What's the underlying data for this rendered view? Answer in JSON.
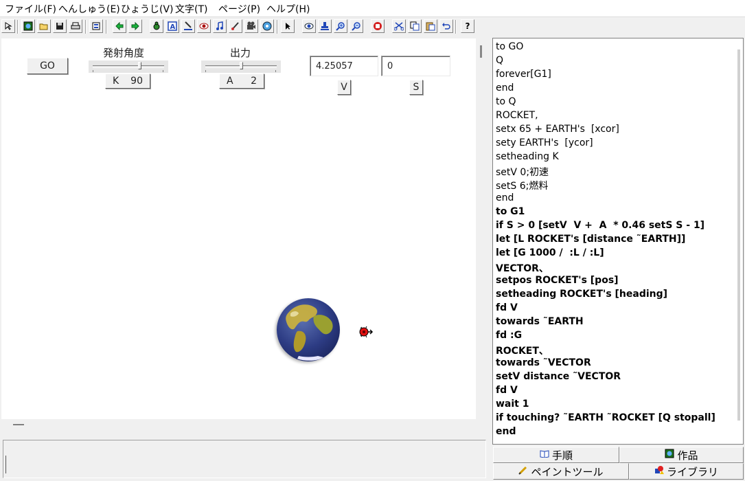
{
  "menu": [
    "ファイル(F)",
    "へんしゅう(E)",
    "ひょうじ(V)",
    "文字(T)",
    "ページ(P)",
    "ヘルプ(H)"
  ],
  "toolbar": {
    "icons": [
      "pointer-icon",
      "new-page-icon",
      "open-icon",
      "save-icon",
      "print-icon",
      "page-list-icon",
      "prev-page-icon",
      "next-page-icon",
      "turtle-icon",
      "text-box-icon",
      "paint-tool-icon",
      "eye-icon",
      "music-icon",
      "brush-icon",
      "video-icon",
      "cd-icon",
      "arrow-icon",
      "eye-watch-icon",
      "stamp-icon",
      "zoom-in-icon",
      "zoom-out-icon",
      "stop-hand-icon",
      "cut-icon",
      "copy-icon",
      "paste-icon",
      "undo-icon",
      "help-icon"
    ],
    "help_label": "?"
  },
  "canvas": {
    "go_button": "GO",
    "angle_label": "発射角度",
    "angle_slider": {
      "name": "K",
      "value": "90",
      "level": 0.55
    },
    "power_label": "出力",
    "power_slider": {
      "name": "A",
      "value": "2",
      "level": 0.5
    },
    "v_value": "4.25057",
    "v_button": "V",
    "s_value": "0",
    "s_button": "S",
    "earth_name": "EARTH",
    "rocket_name": "ROCKET"
  },
  "command_center": {
    "text": ""
  },
  "editor": {
    "lines": [
      {
        "text": "to GO",
        "bold": false
      },
      {
        "text": "Q",
        "bold": false
      },
      {
        "text": "forever[G1]",
        "bold": false
      },
      {
        "text": "end",
        "bold": false
      },
      {
        "text": "to Q",
        "bold": false
      },
      {
        "text": "ROCKET,",
        "bold": false
      },
      {
        "text": "setx 65 + EARTH's  [xcor]",
        "bold": false
      },
      {
        "text": "sety EARTH's  [ycor]",
        "bold": false
      },
      {
        "text": "setheading K",
        "bold": false
      },
      {
        "text": "setV 0;初速",
        "bold": false
      },
      {
        "text": "setS 6;燃料",
        "bold": false
      },
      {
        "text": "end",
        "bold": false
      },
      {
        "text": "to G1",
        "bold": true
      },
      {
        "text": "if S > 0 [setV  V +  A  * 0.46 setS S - 1]",
        "bold": true
      },
      {
        "text": "let [L ROCKET's [distance ˜EARTH]]",
        "bold": true
      },
      {
        "text": "let [G 1000 /  :L / :L]",
        "bold": true
      },
      {
        "text": "VECTOR、",
        "bold": true
      },
      {
        "text": "setpos ROCKET's [pos]",
        "bold": true
      },
      {
        "text": "setheading ROCKET's [heading]",
        "bold": true
      },
      {
        "text": "fd V",
        "bold": true
      },
      {
        "text": "towards ˜EARTH",
        "bold": true
      },
      {
        "text": "fd :G",
        "bold": true
      },
      {
        "text": "ROCKET、",
        "bold": true
      },
      {
        "text": "towards ˜VECTOR",
        "bold": true
      },
      {
        "text": "setV distance ˜VECTOR",
        "bold": true
      },
      {
        "text": "fd V",
        "bold": true
      },
      {
        "text": "wait 1",
        "bold": true
      },
      {
        "text": "if touching? ˜EARTH ˜ROCKET [Q stopall]",
        "bold": true
      },
      {
        "text": "end",
        "bold": true
      }
    ]
  },
  "tabs": {
    "procedures": "手順",
    "project": "作品",
    "paint": "ペイントツール",
    "library": "ライブラリ"
  }
}
